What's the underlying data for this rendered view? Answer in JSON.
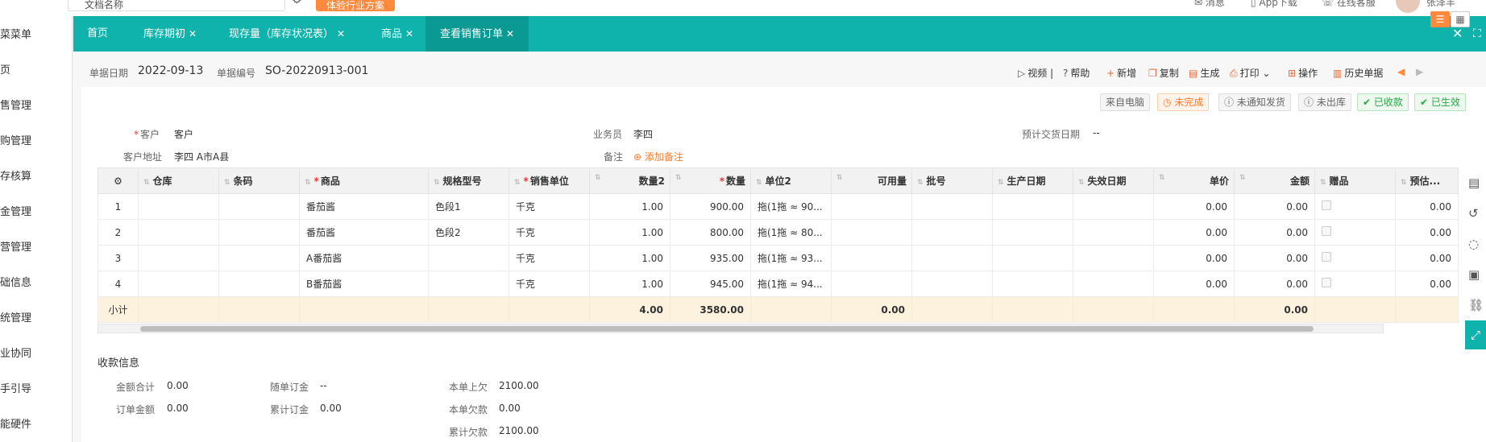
{
  "topbar": {
    "search_value": "文档名称",
    "orange_button": "体验行业方案",
    "links": [
      "消息",
      "App下载",
      "在线客服"
    ],
    "user_name": "张泽丰"
  },
  "sidebar": {
    "items": [
      "菜菜单",
      "页",
      "售管理",
      "购管理",
      "存核算",
      "金管理",
      "营管理",
      "础信息",
      "统管理",
      "业协同",
      "手引导",
      "能硬件"
    ]
  },
  "tabs": [
    {
      "label": "首页",
      "closable": false
    },
    {
      "label": "库存期初",
      "closable": true
    },
    {
      "label": "现存量（库存状况表）",
      "closable": true
    },
    {
      "label": "商品",
      "closable": true
    },
    {
      "label": "查看销售订单",
      "closable": true,
      "active": true
    }
  ],
  "header": {
    "date_label": "单据日期",
    "date_value": "2022-09-13",
    "no_label": "单据编号",
    "no_value": "SO-20220913-001",
    "toolbar": [
      "视频",
      "帮助",
      "新增",
      "复制",
      "生成",
      "打印",
      "操作",
      "历史单据"
    ]
  },
  "badges": [
    "来自电脑",
    "未完成",
    "未通知发货",
    "未出库",
    "已收款",
    "已生效"
  ],
  "form": {
    "customer_label": "客户",
    "customer_value": "客户",
    "address_label": "客户地址",
    "address_value": "李四 A市A县",
    "salesman_label": "业务员",
    "salesman_value": "李四",
    "note_label": "备注",
    "note_add": "添加备注",
    "delivery_label": "预计交货日期",
    "delivery_value": "--"
  },
  "table": {
    "headers": [
      "仓库",
      "条码",
      "商品",
      "规格型号",
      "销售单位",
      "数量2",
      "数量",
      "单位2",
      "可用量",
      "批号",
      "生产日期",
      "失效日期",
      "单价",
      "金额",
      "赠品",
      "预估..."
    ],
    "rows": [
      {
        "no": "1",
        "product": "番茄酱",
        "spec": "色段1",
        "unit": "千克",
        "qty2": "1.00",
        "qty": "900.00",
        "unit2": "拖(1拖 ≈ 90...",
        "price": "0.00",
        "amount": "0.00",
        "est": "0.00"
      },
      {
        "no": "2",
        "product": "番茄酱",
        "spec": "色段2",
        "unit": "千克",
        "qty2": "1.00",
        "qty": "800.00",
        "unit2": "拖(1拖 ≈ 80...",
        "price": "0.00",
        "amount": "0.00",
        "est": "0.00"
      },
      {
        "no": "3",
        "product": "A番茄酱",
        "spec": "",
        "unit": "千克",
        "qty2": "1.00",
        "qty": "935.00",
        "unit2": "拖(1拖 ≈ 93...",
        "price": "0.00",
        "amount": "0.00",
        "est": "0.00"
      },
      {
        "no": "4",
        "product": "B番茄酱",
        "spec": "",
        "unit": "千克",
        "qty2": "1.00",
        "qty": "945.00",
        "unit2": "拖(1拖 ≈ 94...",
        "price": "0.00",
        "amount": "0.00",
        "est": "0.00"
      }
    ],
    "subtotal": {
      "label": "小计",
      "qty2": "4.00",
      "qty": "3580.00",
      "available": "0.00",
      "amount": "0.00"
    }
  },
  "payment": {
    "title": "收款信息",
    "total_amount_label": "金额合计",
    "total_amount_value": "0.00",
    "order_amount_label": "订单金额",
    "order_amount_value": "0.00",
    "deposit_label": "随单订金",
    "deposit_value": "--",
    "cum_deposit_label": "累计订金",
    "cum_deposit_value": "0.00",
    "prev_owed_label": "本单上欠",
    "prev_owed_value": "2100.00",
    "this_owed_label": "本单欠款",
    "this_owed_value": "0.00",
    "cum_owed_label": "累计欠款",
    "cum_owed_value": "2100.00"
  },
  "colors": {
    "teal": "#0fb3ab",
    "orange": "#ff8a3d",
    "red": "#e53935",
    "green": "#27a745"
  }
}
